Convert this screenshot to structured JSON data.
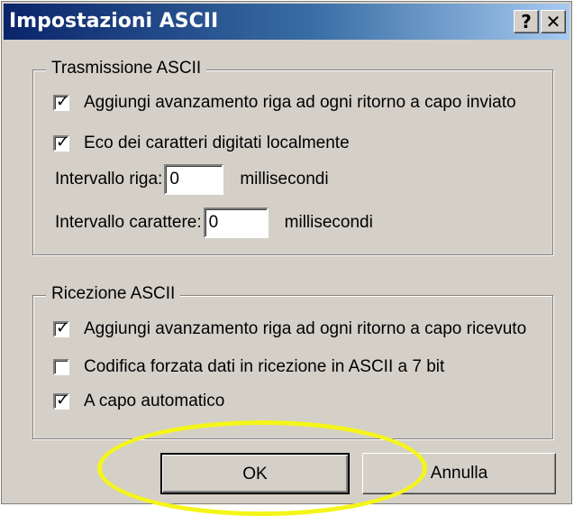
{
  "dialog": {
    "title": "Impostazioni ASCII",
    "help_label": "?",
    "close_label": "✕"
  },
  "transmission": {
    "legend": "Trasmissione ASCII",
    "options": [
      {
        "label": "Aggiungi avanzamento riga ad ogni ritorno a capo inviato",
        "checked": true,
        "mark": "✓"
      },
      {
        "label": "Eco dei caratteri digitati localmente",
        "checked": true,
        "mark": "✓"
      }
    ],
    "line_delay": {
      "label": "Intervallo riga:",
      "value": "0",
      "unit": "millisecondi"
    },
    "char_delay": {
      "label": "Intervallo carattere:",
      "value": "0",
      "unit": "millisecondi"
    }
  },
  "reception": {
    "legend": "Ricezione ASCII",
    "options": [
      {
        "label": "Aggiungi avanzamento riga ad ogni ritorno a capo ricevuto",
        "checked": true,
        "mark": "✓"
      },
      {
        "label": "Codifica forzata dati in ricezione in ASCII a 7 bit",
        "checked": false,
        "mark": ""
      },
      {
        "label": "A capo automatico",
        "checked": true,
        "mark": "✓"
      }
    ]
  },
  "buttons": {
    "ok": "OK",
    "cancel": "Annulla"
  },
  "colors": {
    "highlight": "#f5f51a",
    "titlebar_start": "#0a246a",
    "titlebar_end": "#a6caf0",
    "face": "#d4d0c8"
  }
}
